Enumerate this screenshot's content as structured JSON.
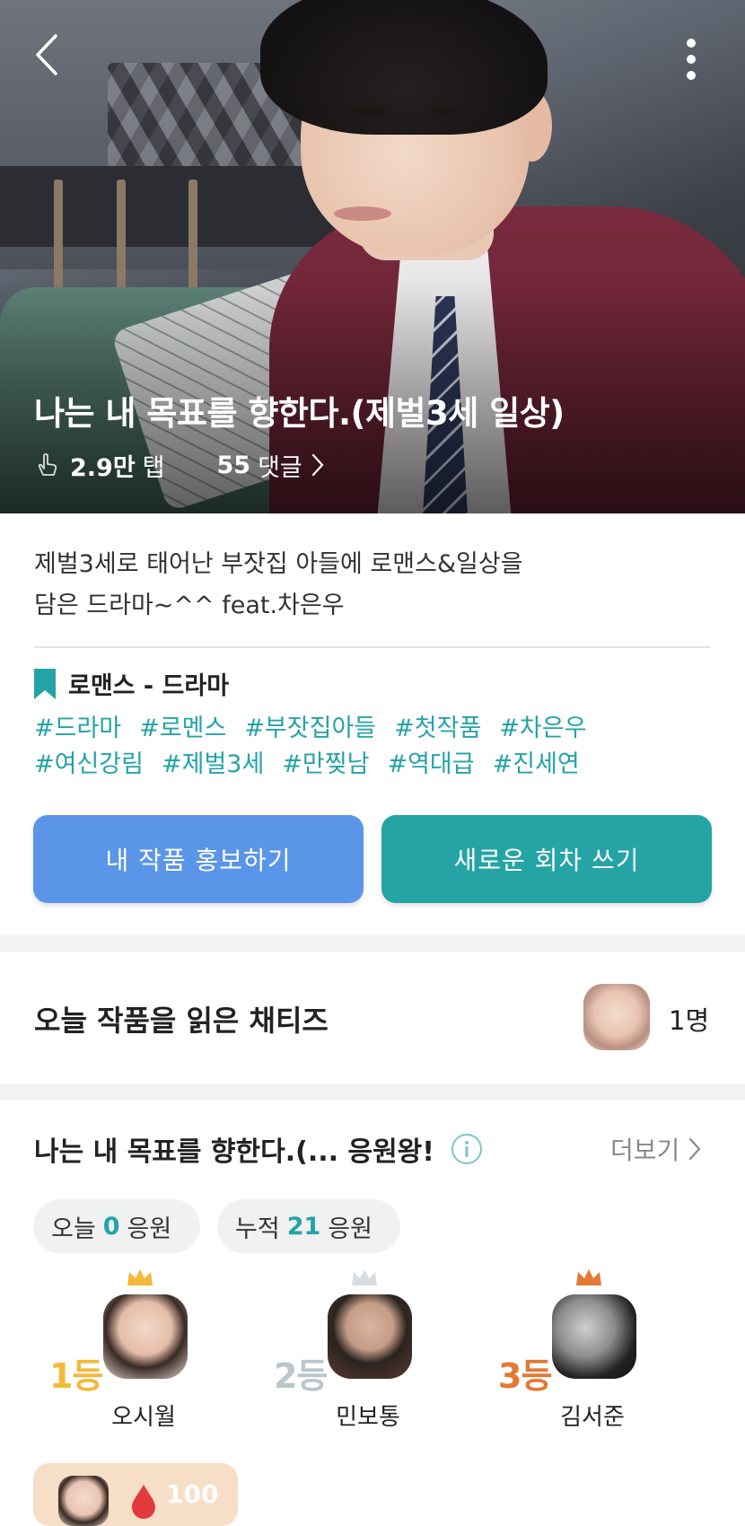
{
  "hero": {
    "title": "나는 내 목표를 향한다.(제벌3세 일상)",
    "taps_value": "2.9만",
    "taps_label": "탭",
    "comments_value": "55",
    "comments_label": "댓글"
  },
  "description": {
    "line1": "제벌3세로 태어난 부잣집 아들에 로맨스&일상을",
    "line2": "담은 드라마~^^ feat.차은우"
  },
  "genre": "로맨스 - 드라마",
  "tags_row1": [
    "#드라마",
    "#로멘스",
    "#부잣집아들",
    "#첫작품",
    "#차은우"
  ],
  "tags_row2": [
    "#여신강림",
    "#제벌3세",
    "#만찢남",
    "#역대급",
    "#진세연"
  ],
  "buttons": {
    "promote": "내 작품 홍보하기",
    "new_episode": "새로운 회차 쓰기"
  },
  "readers": {
    "title": "오늘 작품을 읽은 채티즈",
    "count": "1명"
  },
  "support": {
    "title": "나는 내 목표를 향한다.(... 응원왕!",
    "more": "더보기",
    "today_prefix": "오늘",
    "today_value": "0",
    "today_suffix": "응원",
    "total_prefix": "누적",
    "total_value": "21",
    "total_suffix": "응원",
    "ranks": [
      {
        "rank": "1등",
        "name": "오시월"
      },
      {
        "rank": "2등",
        "name": "민보통"
      },
      {
        "rank": "3등",
        "name": "김서준"
      }
    ],
    "mini_value": "100"
  },
  "colors": {
    "accent_teal": "#24a3a7",
    "promo_blue": "#5b95e8",
    "gold": "#f4b93a",
    "silver": "#b9c6cb",
    "bronze": "#e27935"
  }
}
